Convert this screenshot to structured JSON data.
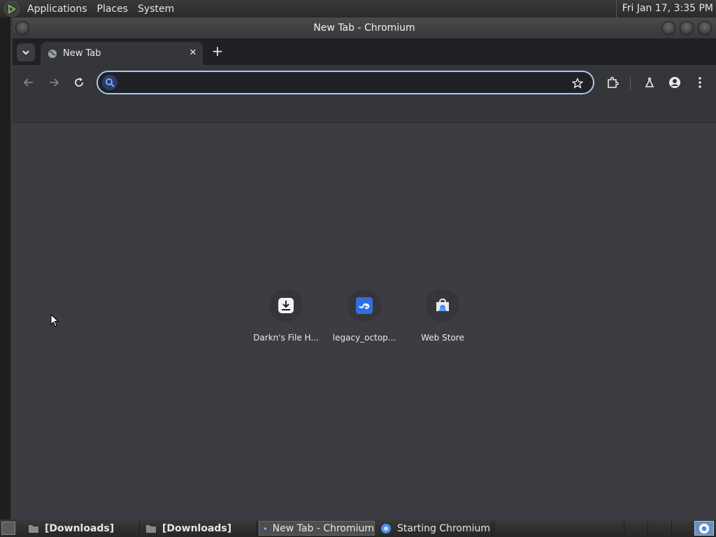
{
  "top_panel": {
    "menus": [
      "Applications",
      "Places",
      "System"
    ],
    "clock": "Fri Jan 17,  3:35 PM"
  },
  "window": {
    "title": "New Tab - Chromium"
  },
  "tabs": [
    {
      "label": "New Tab",
      "favicon": "globe-icon",
      "active": true
    }
  ],
  "toolbar": {
    "omnibox_value": "",
    "omnibox_placeholder": "",
    "accent_color": "#a8c7fa"
  },
  "shortcuts": [
    {
      "label": "Darkn's File H...",
      "icon": "download-icon"
    },
    {
      "label": "legacy_octop...",
      "icon": "octopus-icon"
    },
    {
      "label": "Web Store",
      "icon": "web-store-icon"
    }
  ],
  "taskbar": {
    "tasks": [
      {
        "label": "[Downloads]",
        "icon": "folder-icon",
        "bold": true,
        "active": false
      },
      {
        "label": "[Downloads]",
        "icon": "folder-icon",
        "bold": true,
        "active": false
      },
      {
        "label": "New Tab - Chromium",
        "icon": "chromium-icon",
        "bold": false,
        "active": true
      },
      {
        "label": "Starting Chromium",
        "icon": "chromium-icon",
        "bold": false,
        "active": false
      }
    ]
  },
  "colors": {
    "content_bg": "#3c3c42",
    "toolbar_bg": "#35363a",
    "tabstrip_bg": "#202124",
    "text": "#e8eaed"
  }
}
